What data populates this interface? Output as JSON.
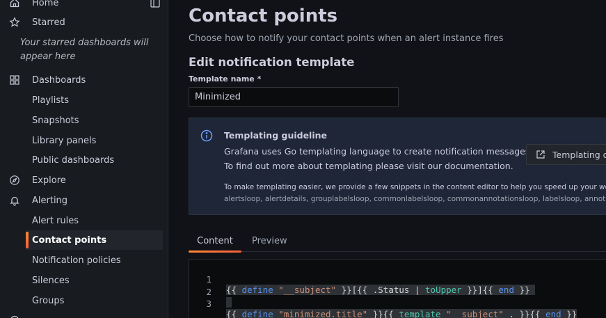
{
  "sidebar": {
    "items": [
      {
        "label": "Home",
        "icon": "home-icon"
      },
      {
        "label": "Starred",
        "icon": "star-icon"
      },
      {
        "label": "Dashboards",
        "icon": "apps-icon"
      },
      {
        "label": "Playlists"
      },
      {
        "label": "Snapshots"
      },
      {
        "label": "Library panels"
      },
      {
        "label": "Public dashboards"
      },
      {
        "label": "Explore",
        "icon": "compass-icon"
      },
      {
        "label": "Alerting",
        "icon": "bell-icon"
      },
      {
        "label": "Alert rules"
      },
      {
        "label": "Contact points",
        "active": true
      },
      {
        "label": "Notification policies"
      },
      {
        "label": "Silences"
      },
      {
        "label": "Groups"
      }
    ],
    "starred_note": "Your starred dashboards will appear here"
  },
  "page": {
    "title": "Contact points",
    "subtitle": "Choose how to notify your contact points when an alert instance fires",
    "section_title": "Edit notification template",
    "template_name_label": "Template name *",
    "template_name_value": "Minimized"
  },
  "guideline": {
    "title": "Templating guideline",
    "text1": "Grafana uses Go templating language to create notification messages.",
    "text2": "To find out more about templating please visit our documentation.",
    "button_label": "Templating d",
    "small_text": "To make templating easier, we provide a few snippets in the content editor to help you speed up your wor",
    "snippets": "alertsloop, alertdetails, grouplabelsloop, commonlabelsloop, commonannotationsloop, labelsloop, annot"
  },
  "tabs": [
    {
      "label": "Content",
      "active": true
    },
    {
      "label": "Preview"
    }
  ],
  "editor": {
    "lines": [
      {
        "num": "1"
      },
      {
        "num": "2"
      },
      {
        "num": "3"
      }
    ]
  },
  "colors": {
    "accent": "#f55f3e",
    "accent_start": "#ff8833",
    "info": "#6e9fff"
  }
}
